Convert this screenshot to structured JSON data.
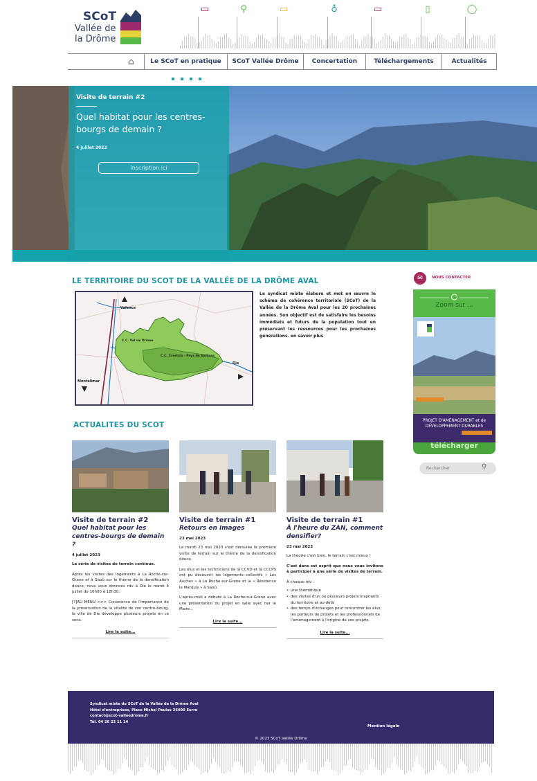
{
  "header": {
    "logo_line1": "SCoT",
    "logo_line2": "Vallée de",
    "logo_line3": "la Drôme",
    "top_icons": [
      "chat-icon",
      "map-pin-icon",
      "speech-icon",
      "lightbulb-icon",
      "discussion-icon",
      "document-icon",
      "check-circle-icon"
    ]
  },
  "nav": {
    "home_icon": "⌂",
    "items": [
      "Le SCoT en pratique",
      "SCoT Vallée Drôme",
      "Concertation",
      "Téléchargements",
      "Actualités"
    ]
  },
  "hero": {
    "kicker": "Visite de terrain #2",
    "title": "Quel habitat pour les centres-bourgs de demain ?",
    "date": "4 juillet 2023",
    "button": "Inscription ici"
  },
  "territoire": {
    "title": "LE TERRITOIRE DU SCOT DE LA VALLÉE DE LA DRÔME AVAL",
    "text": "Le syndicat mixte élabore et met en œuvre le schéma de cohérence territoriale (SCoT) de la Vallée de la Drôme Aval pour les 20 prochaines années. Son objectif est de satisfaire les besoins immédiats et futurs de la population tout en préservant les ressources pour les prochaines générations. en savoir plus",
    "map_labels": {
      "valence": "Valence",
      "die": "Die",
      "montelimar": "Montélimar",
      "cc_val_drome": "C.C. Val de Drôme",
      "cc_crestois": "C.C. Crestois - Pays de Saillans"
    }
  },
  "sidebar": {
    "contact": "NOUS CONTACTER",
    "zoom_title": "Zoom sur ...",
    "zoom_caption": "PROJET D'AMÉNAGEMENT et de DÉVELOPPEMENT DURABLES",
    "zoom_download": "télécharger",
    "search_placeholder": "Rechercher"
  },
  "news": {
    "title": "ACTUALITES DU SCOT",
    "read_more": "Lire la suite...",
    "cards": [
      {
        "title": "Visite de terrain #2",
        "subtitle": "Quel habitat pour les centres-bourgs de demain ?",
        "date": "4 juillet 2023",
        "p1": "La série de visites de terrain continue.",
        "p2": "Après les visites des logements à La Roche-sur-Grane et à Saoû sur le thème de la densification douce, nous vous donnons rdv à Die le mardi 4 juillet de 16h00 à 18h30.",
        "p3": "[?]AU MENU >>> Conscience de l'importance de la préservation de la vitalité de son centre-bourg, la ville de Die développe plusieurs projets en ce sens."
      },
      {
        "title": "Visite de terrain #1",
        "subtitle": "Retours en images",
        "date": "23 mai 2023",
        "p1": "Le mardi 23 mai 2023 s'est déroulée la première visite de terrain sur le thème de la densification douce.",
        "p2": "Les élus et les techniciens de la CCVD et la CCCPS ont pu découvrir les logements collectifs « Les Auches » à La Roche-sur-Grane et la « Résidence le Marquis » à Saoû.",
        "p3": "L'après-midi a débuté à La Roche-sur-Grane avec une présentation du projet en salle avec ner le Maire..."
      },
      {
        "title": "Visite de terrain #1",
        "subtitle": "À l'heure du ZAN, comment densifier?",
        "date": "23 mai 2023",
        "p1": "La théorie c'est bien, le terrain c'est mieux !",
        "p2": "C'est dans cet esprit que nous vous invitons à participer à une série de visites de terrain.",
        "p3": "À chaque rdv :",
        "bullets": [
          "une thématique",
          "des visites d'un ou plusieurs projets inspirants du territoire et au-delà",
          "des temps d'échanges pour rencontrer les élus, les porteurs de projets et les professionnels de l'aménagement à l'origine de ces projets."
        ]
      }
    ]
  },
  "footer": {
    "line1": "Syndicat mixte du SCoT de la Vallée de la Drôme Aval",
    "line2": "Hôtel d'entreprises, Place Michel Paulus 26400 Eurre",
    "line3": "contact@scot-valleedrome.fr",
    "line4": "Tél. 04 26 22 11 14",
    "legal": "Mention légale",
    "copyright": "© 2023 SCoT Vallée Drôme"
  },
  "colors": {
    "teal": "#15a3ad",
    "navy": "#362b6b",
    "green": "#56b948",
    "magenta": "#a8285c"
  }
}
